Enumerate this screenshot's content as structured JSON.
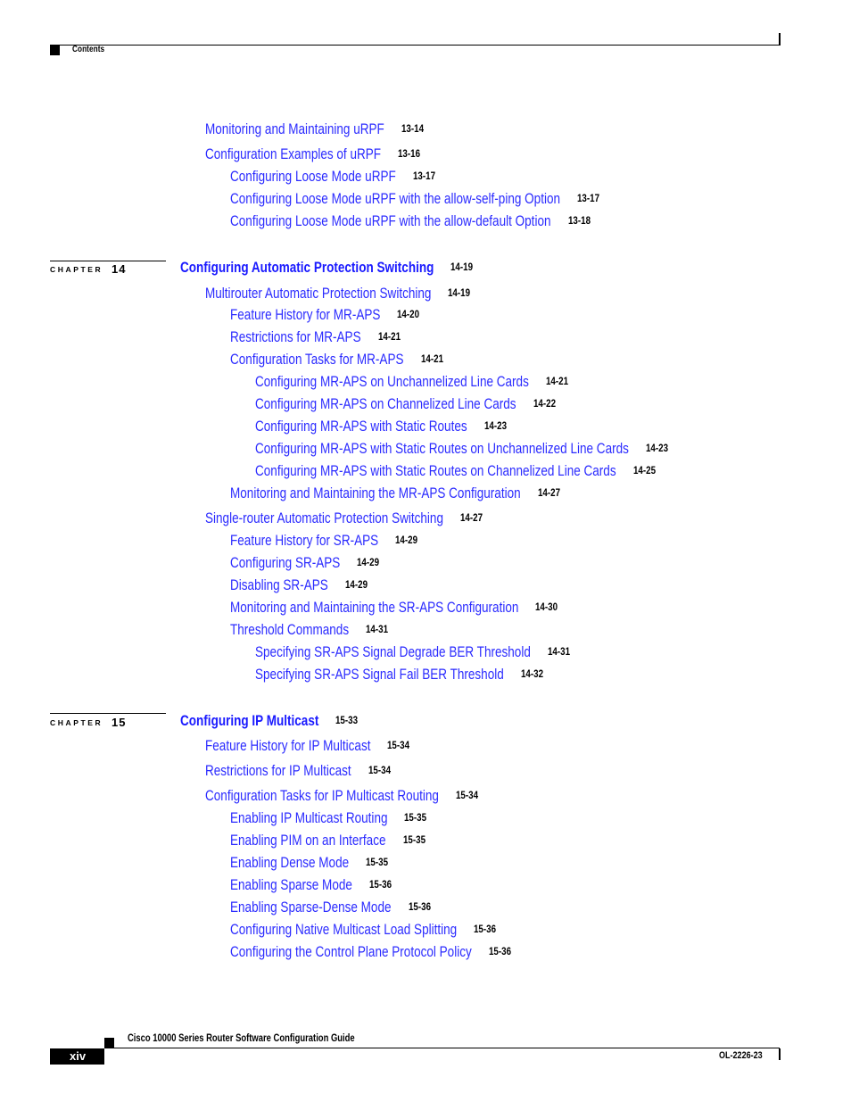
{
  "header": {
    "section_label": "Contents"
  },
  "toc": {
    "pre_entries": [
      {
        "title": "Monitoring and Maintaining uRPF",
        "page": "13-14",
        "level": 1
      },
      {
        "title": "Configuration Examples of uRPF",
        "page": "13-16",
        "level": 1
      },
      {
        "title": "Configuring Loose Mode uRPF",
        "page": "13-17",
        "level": 2
      },
      {
        "title": "Configuring Loose Mode uRPF with the allow-self-ping Option",
        "page": "13-17",
        "level": 2
      },
      {
        "title": "Configuring Loose Mode uRPF with the allow-default Option",
        "page": "13-18",
        "level": 2
      }
    ],
    "chapters": [
      {
        "label": "CHAPTER",
        "number": "14",
        "title": "Configuring Automatic Protection Switching",
        "page": "14-19",
        "entries": [
          {
            "title": "Multirouter Automatic Protection Switching",
            "page": "14-19",
            "level": 1
          },
          {
            "title": "Feature History for MR-APS",
            "page": "14-20",
            "level": 2
          },
          {
            "title": "Restrictions for MR-APS",
            "page": "14-21",
            "level": 2
          },
          {
            "title": "Configuration Tasks for MR-APS",
            "page": "14-21",
            "level": 2
          },
          {
            "title": "Configuring MR-APS on Unchannelized Line Cards",
            "page": "14-21",
            "level": 3
          },
          {
            "title": "Configuring MR-APS on Channelized Line Cards",
            "page": "14-22",
            "level": 3
          },
          {
            "title": "Configuring MR-APS with Static Routes",
            "page": "14-23",
            "level": 3
          },
          {
            "title": "Configuring MR-APS with Static Routes on Unchannelized Line Cards",
            "page": "14-23",
            "level": 3
          },
          {
            "title": "Configuring MR-APS with Static Routes on Channelized Line Cards",
            "page": "14-25",
            "level": 3
          },
          {
            "title": "Monitoring and Maintaining the MR-APS Configuration",
            "page": "14-27",
            "level": 2
          },
          {
            "title": "Single-router Automatic Protection Switching",
            "page": "14-27",
            "level": 1
          },
          {
            "title": "Feature History for SR-APS",
            "page": "14-29",
            "level": 2
          },
          {
            "title": "Configuring SR-APS",
            "page": "14-29",
            "level": 2
          },
          {
            "title": "Disabling SR-APS",
            "page": "14-29",
            "level": 2
          },
          {
            "title": "Monitoring and Maintaining the SR-APS Configuration",
            "page": "14-30",
            "level": 2
          },
          {
            "title": "Threshold Commands",
            "page": "14-31",
            "level": 2
          },
          {
            "title": "Specifying SR-APS Signal Degrade BER Threshold",
            "page": "14-31",
            "level": 3
          },
          {
            "title": "Specifying SR-APS Signal Fail BER Threshold",
            "page": "14-32",
            "level": 3
          }
        ]
      },
      {
        "label": "CHAPTER",
        "number": "15",
        "title": "Configuring IP Multicast",
        "page": "15-33",
        "entries": [
          {
            "title": "Feature History for IP Multicast",
            "page": "15-34",
            "level": 1
          },
          {
            "title": "Restrictions for IP Multicast",
            "page": "15-34",
            "level": 1
          },
          {
            "title": "Configuration Tasks for IP Multicast Routing",
            "page": "15-34",
            "level": 1
          },
          {
            "title": "Enabling IP Multicast Routing",
            "page": "15-35",
            "level": 2
          },
          {
            "title": "Enabling PIM on an Interface",
            "page": "15-35",
            "level": 2
          },
          {
            "title": "Enabling Dense Mode",
            "page": "15-35",
            "level": 2
          },
          {
            "title": "Enabling Sparse Mode",
            "page": "15-36",
            "level": 2
          },
          {
            "title": "Enabling Sparse-Dense Mode",
            "page": "15-36",
            "level": 2
          },
          {
            "title": "Configuring Native Multicast Load Splitting",
            "page": "15-36",
            "level": 2
          },
          {
            "title": "Configuring the Control Plane Protocol Policy",
            "page": "15-36",
            "level": 2
          }
        ]
      }
    ]
  },
  "footer": {
    "guide_title": "Cisco 10000 Series Router Software Configuration Guide",
    "page_number": "xiv",
    "doc_id": "OL-2226-23"
  },
  "colors": {
    "link": "#2b2bff",
    "chapter_title": "#1a1aff",
    "text": "#000000"
  }
}
